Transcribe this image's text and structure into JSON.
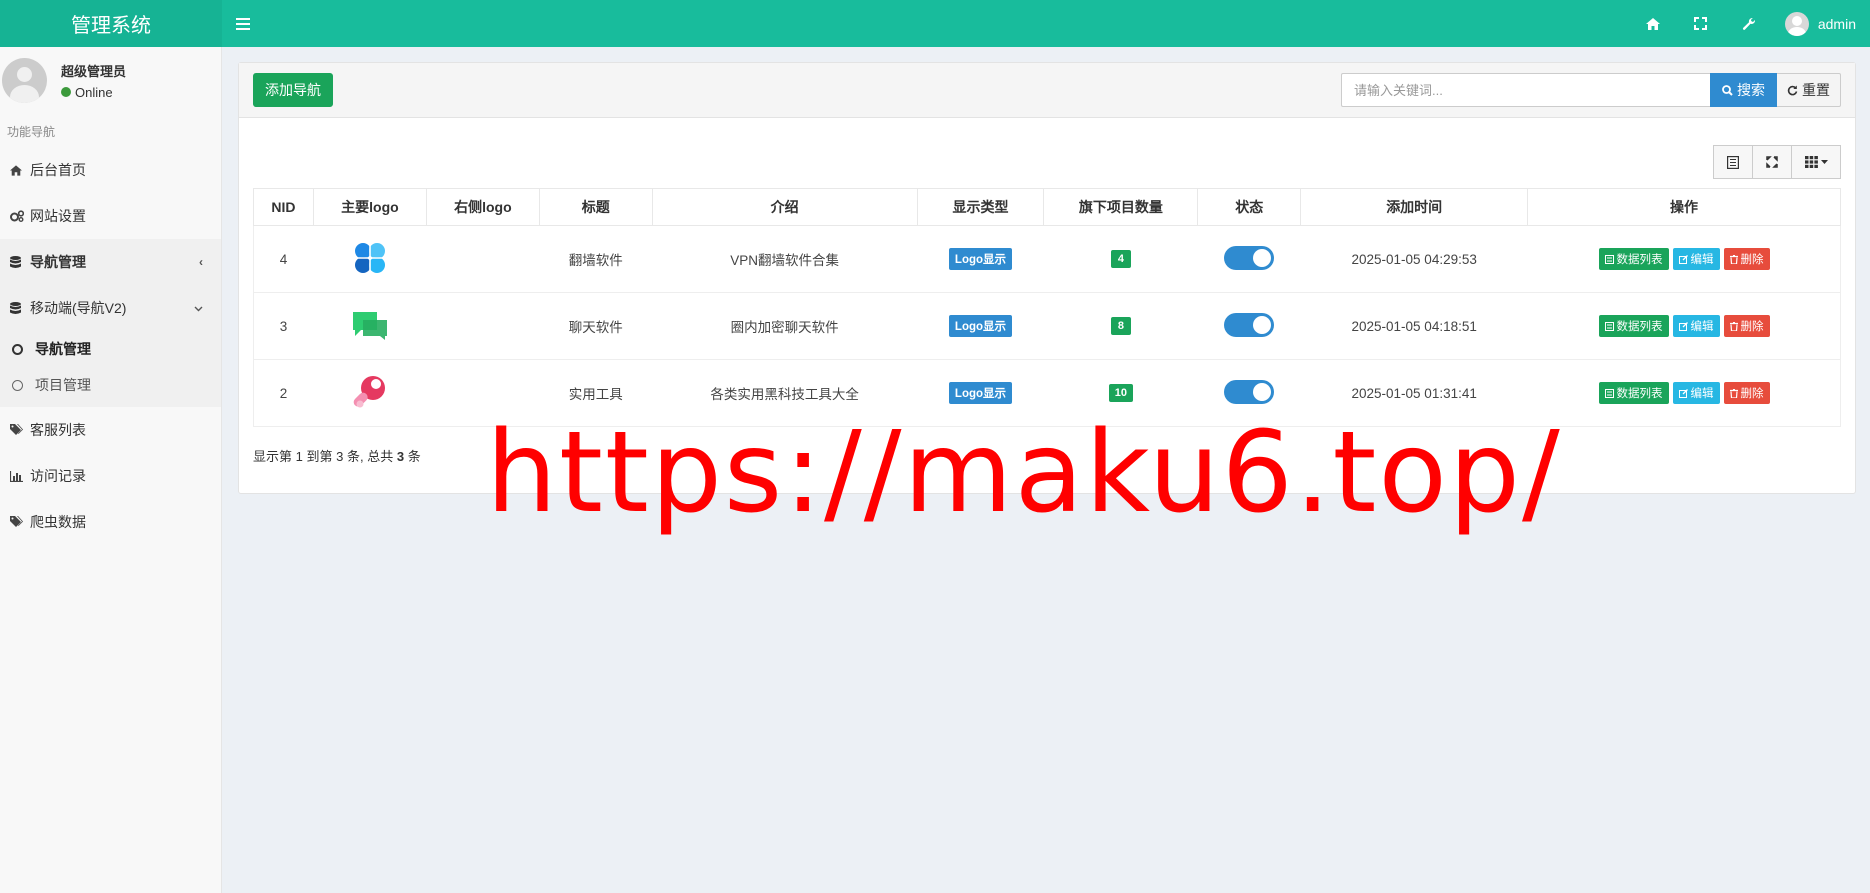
{
  "header": {
    "brand": "管理系统",
    "user_name": "admin"
  },
  "sidebar": {
    "user": {
      "name": "超级管理员",
      "status": "Online"
    },
    "section_title": "功能导航",
    "items": [
      {
        "label": "后台首页",
        "icon": "home-icon"
      },
      {
        "label": "网站设置",
        "icon": "cogs-icon"
      },
      {
        "label": "导航管理",
        "icon": "database-icon"
      },
      {
        "label": "移动端(导航V2)",
        "icon": "database-icon"
      },
      {
        "label": "客服列表",
        "icon": "tags-icon"
      },
      {
        "label": "访问记录",
        "icon": "bar-chart-icon"
      },
      {
        "label": "爬虫数据",
        "icon": "tags-icon"
      }
    ],
    "subitems": [
      {
        "label": "导航管理"
      },
      {
        "label": "项目管理"
      }
    ]
  },
  "toolbar": {
    "add_label": "添加导航",
    "search_placeholder": "请输入关键词...",
    "search_label": "搜索",
    "reset_label": "重置"
  },
  "table": {
    "columns": [
      "NID",
      "主要logo",
      "右侧logo",
      "标题",
      "介绍",
      "显示类型",
      "旗下项目数量",
      "状态",
      "添加时间",
      "操作"
    ],
    "rows": [
      {
        "nid": "4",
        "logo": "blue-flower-logo",
        "title": "翻墙软件",
        "intro": "VPN翻墙软件合集",
        "type": "Logo显示",
        "count": "4",
        "status_on": true,
        "time": "2025-01-05 04:29:53"
      },
      {
        "nid": "3",
        "logo": "green-chat-logo",
        "title": "聊天软件",
        "intro": "圈内加密聊天软件",
        "type": "Logo显示",
        "count": "8",
        "status_on": true,
        "time": "2025-01-05 04:18:51"
      },
      {
        "nid": "2",
        "logo": "red-wrench-logo",
        "title": "实用工具",
        "intro": "各类实用黑科技工具大全",
        "type": "Logo显示",
        "count": "10",
        "status_on": true,
        "time": "2025-01-05 01:31:41"
      }
    ],
    "ops": {
      "list": "数据列表",
      "edit": "编辑",
      "delete": "删除"
    }
  },
  "pager": {
    "prefix": "显示第",
    "from": "1",
    "mid1": "到第",
    "to": "3",
    "mid2": "条, 总共",
    "total": "3",
    "suffix": "条"
  },
  "watermark": "https://maku6.top/",
  "colors": {
    "header": "#18bc9c",
    "success": "#1aa45a",
    "primary": "#2f8bd0",
    "info": "#27b7e3",
    "danger": "#e74c3c",
    "watermark": "#ff0000"
  }
}
